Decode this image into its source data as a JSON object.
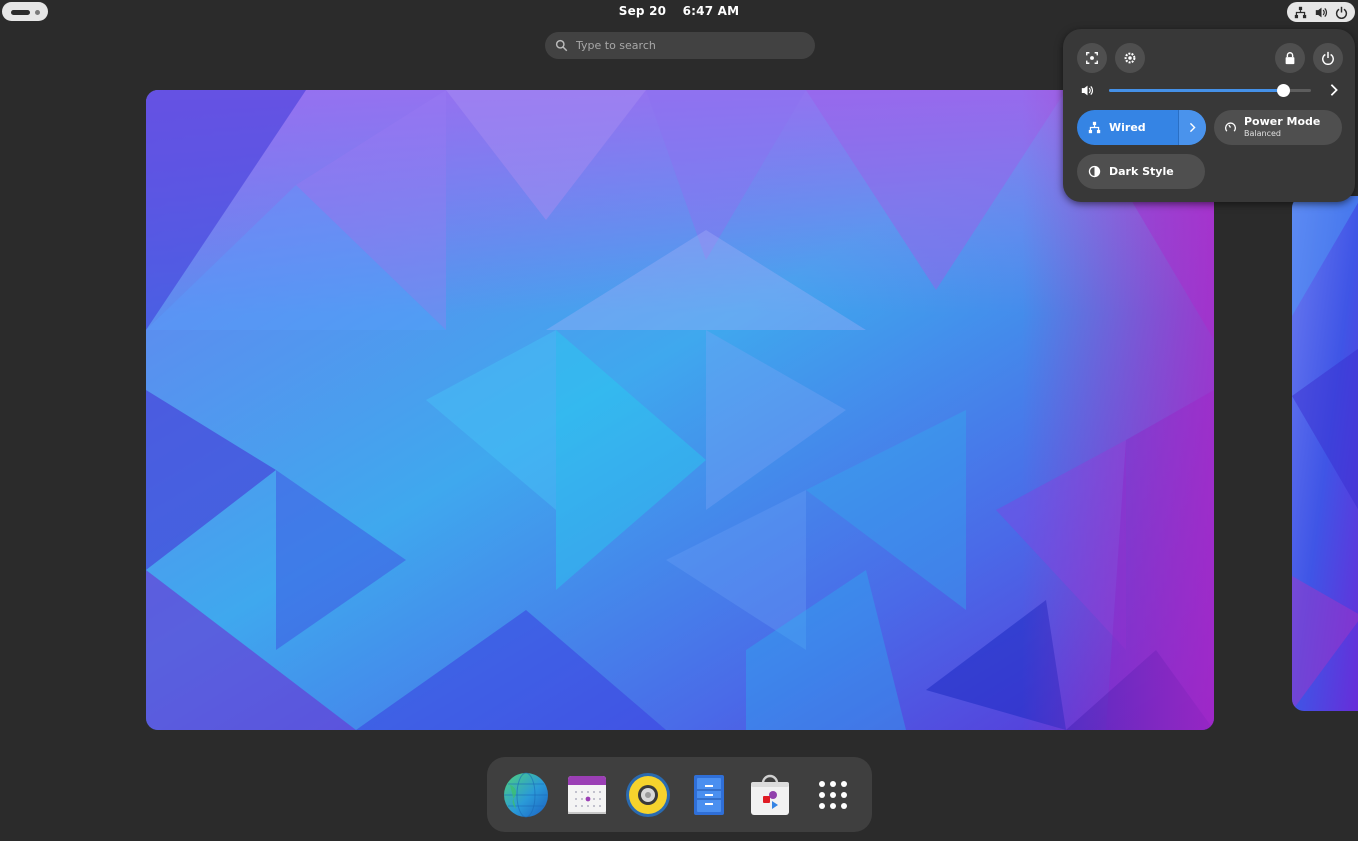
{
  "topbar": {
    "date": "Sep 20",
    "time": "6:47 AM",
    "icons": [
      "network-wired-icon",
      "volume-icon",
      "power-icon"
    ]
  },
  "search": {
    "placeholder": "Type to search"
  },
  "quick_settings": {
    "buttons": [
      "screenshot-icon",
      "settings-icon",
      "lock-icon",
      "power-off-icon"
    ],
    "volume": {
      "level": 0.86
    },
    "toggles": {
      "wired": {
        "label": "Wired",
        "active": true
      },
      "power_mode": {
        "label": "Power Mode",
        "subtitle": "Balanced"
      },
      "dark_style": {
        "label": "Dark Style",
        "active": false
      }
    }
  },
  "dash": {
    "apps": [
      "web-browser-icon",
      "calendar-icon",
      "rhythmbox-speaker-icon",
      "files-cabinet-icon",
      "software-store-icon",
      "show-apps-grid-icon"
    ]
  },
  "colors": {
    "accent": "#3584e4",
    "panel": "#383838",
    "background": "#2b2b2b"
  }
}
